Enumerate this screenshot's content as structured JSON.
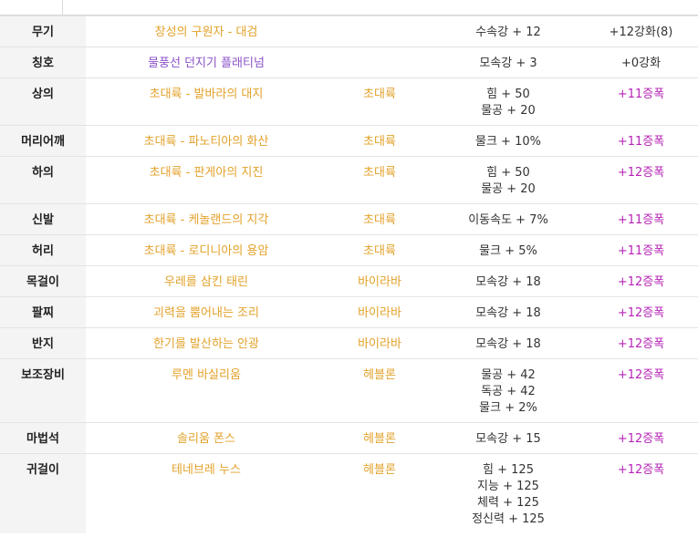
{
  "header": {
    "tabs": [
      "",
      "",
      "",
      "",
      "",
      "",
      ""
    ]
  },
  "rows": [
    {
      "slot": "무기",
      "name": "창성의 구원자 - 대검",
      "set": "",
      "options": [
        "수속강 + 12"
      ],
      "upgrade": "+12강화(8)",
      "amplified": false,
      "name_color": "orange"
    },
    {
      "slot": "칭호",
      "name": "물풍선 던지기 플래티넘",
      "set": "",
      "options": [
        "모속강 + 3"
      ],
      "upgrade": "+0강화",
      "amplified": false,
      "name_color": "purple"
    },
    {
      "slot": "상의",
      "name": "초대륙 - 발바라의 대지",
      "set": "초대륙",
      "options": [
        "힘 + 50",
        "물공 + 20"
      ],
      "upgrade": "+11증폭",
      "amplified": true,
      "name_color": "orange"
    },
    {
      "slot": "머리어깨",
      "name": "초대륙 - 파노티아의 화산",
      "set": "초대륙",
      "options": [
        "물크 + 10%"
      ],
      "upgrade": "+11증폭",
      "amplified": true,
      "name_color": "orange"
    },
    {
      "slot": "하의",
      "name": "초대륙 - 판게아의 지진",
      "set": "초대륙",
      "options": [
        "힘 + 50",
        "물공 + 20"
      ],
      "upgrade": "+12증폭",
      "amplified": true,
      "name_color": "orange"
    },
    {
      "slot": "신발",
      "name": "초대륙 - 케놀랜드의 지각",
      "set": "초대륙",
      "options": [
        "이동속도 + 7%"
      ],
      "upgrade": "+11증폭",
      "amplified": true,
      "name_color": "orange"
    },
    {
      "slot": "허리",
      "name": "초대륙 - 로디니아의 용암",
      "set": "초대륙",
      "options": [
        "물크 + 5%"
      ],
      "upgrade": "+11증폭",
      "amplified": true,
      "name_color": "orange"
    },
    {
      "slot": "목걸이",
      "name": "우레를 삼킨 태린",
      "set": "바이라바",
      "options": [
        "모속강 + 18"
      ],
      "upgrade": "+12증폭",
      "amplified": true,
      "name_color": "orange"
    },
    {
      "slot": "팔찌",
      "name": "괴력을 뿜어내는 조리",
      "set": "바이라바",
      "options": [
        "모속강 + 18"
      ],
      "upgrade": "+12증폭",
      "amplified": true,
      "name_color": "orange"
    },
    {
      "slot": "반지",
      "name": "한기를 발산하는 안광",
      "set": "바이라바",
      "options": [
        "모속강 + 18"
      ],
      "upgrade": "+12증폭",
      "amplified": true,
      "name_color": "orange"
    },
    {
      "slot": "보조장비",
      "name": "루멘 바실리움",
      "set": "헤블론",
      "options": [
        "물공 + 42",
        "독공 + 42",
        "물크 + 2%"
      ],
      "upgrade": "+12증폭",
      "amplified": true,
      "name_color": "orange"
    },
    {
      "slot": "마법석",
      "name": "솔리움 폰스",
      "set": "헤블론",
      "options": [
        "모속강 + 15"
      ],
      "upgrade": "+12증폭",
      "amplified": true,
      "name_color": "orange"
    },
    {
      "slot": "귀걸이",
      "name": "테네브레 누스",
      "set": "헤블론",
      "options": [
        "힘 + 125",
        "지능 + 125",
        "체력 + 125",
        "정신력 + 125"
      ],
      "upgrade": "+12증폭",
      "amplified": true,
      "name_color": "orange"
    }
  ],
  "colors": {
    "orange": "#e2a22a",
    "purple": "#8a52c9",
    "amplified": "#b623b6",
    "slot_bg": "#f4f4f4"
  }
}
